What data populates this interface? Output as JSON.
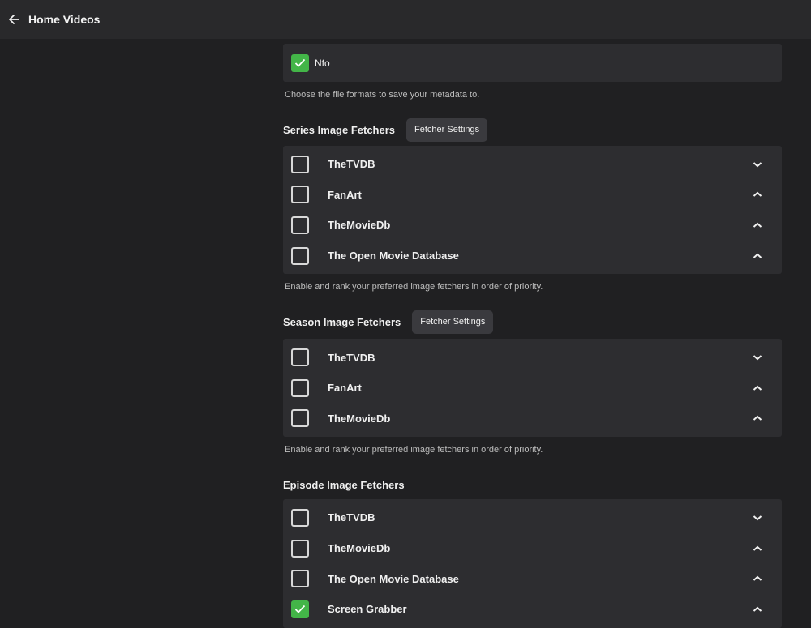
{
  "header": {
    "title": "Home Videos"
  },
  "metadata_savers": {
    "items": [
      {
        "label": "Nfo",
        "checked": true
      }
    ],
    "help": "Choose the file formats to save your metadata to."
  },
  "sections": [
    {
      "title": "Series Image Fetchers",
      "button": "Fetcher Settings",
      "help": "Enable and rank your preferred image fetchers in order of priority.",
      "items": [
        {
          "label": "TheTVDB",
          "checked": false,
          "arrow": "down"
        },
        {
          "label": "FanArt",
          "checked": false,
          "arrow": "up"
        },
        {
          "label": "TheMovieDb",
          "checked": false,
          "arrow": "up"
        },
        {
          "label": "The Open Movie Database",
          "checked": false,
          "arrow": "up"
        }
      ]
    },
    {
      "title": "Season Image Fetchers",
      "button": "Fetcher Settings",
      "help": "Enable and rank your preferred image fetchers in order of priority.",
      "items": [
        {
          "label": "TheTVDB",
          "checked": false,
          "arrow": "down"
        },
        {
          "label": "FanArt",
          "checked": false,
          "arrow": "up"
        },
        {
          "label": "TheMovieDb",
          "checked": false,
          "arrow": "up"
        }
      ]
    },
    {
      "title": "Episode Image Fetchers",
      "button": "",
      "help": "",
      "items": [
        {
          "label": "TheTVDB",
          "checked": false,
          "arrow": "down"
        },
        {
          "label": "TheMovieDb",
          "checked": false,
          "arrow": "up"
        },
        {
          "label": "The Open Movie Database",
          "checked": false,
          "arrow": "up"
        },
        {
          "label": "Screen Grabber",
          "checked": true,
          "arrow": "up"
        }
      ]
    }
  ],
  "colors": {
    "accent": "#43b548",
    "panel": "#2d2d30",
    "background": "#202022",
    "header": "#29292b"
  },
  "icons": {
    "back": "arrow-left-icon",
    "check": "check-icon",
    "down": "chevron-down-icon",
    "up": "chevron-up-icon"
  }
}
